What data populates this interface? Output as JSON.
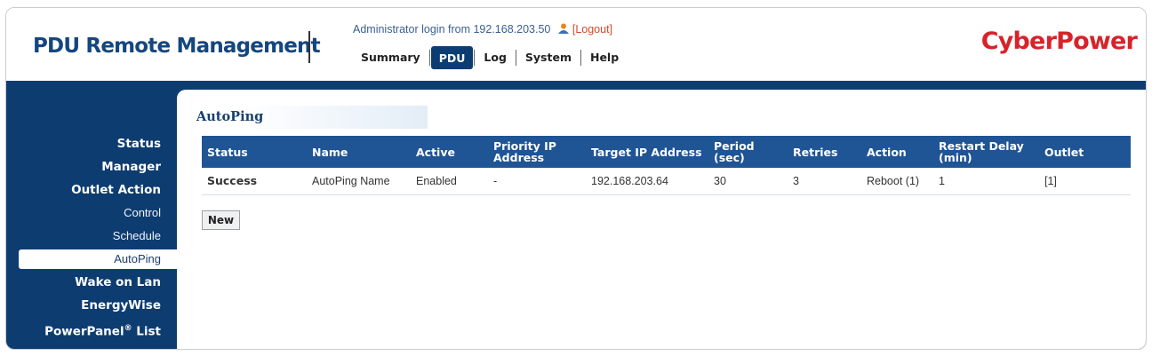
{
  "header": {
    "app_title": "PDU Remote Management",
    "login_prefix": "Administrator login from 192.168.203.50",
    "logout_label": "[Logout]",
    "brand": "CyberPower"
  },
  "nav": {
    "tabs": [
      {
        "label": "Summary"
      },
      {
        "label": "PDU"
      },
      {
        "label": "Log"
      },
      {
        "label": "System"
      },
      {
        "label": "Help"
      }
    ],
    "active": "PDU"
  },
  "sidebar": {
    "items": [
      {
        "label": "Status"
      },
      {
        "label": "Manager"
      },
      {
        "label": "Outlet Action"
      },
      {
        "label": "Control"
      },
      {
        "label": "Schedule"
      },
      {
        "label": "AutoPing"
      },
      {
        "label": "Wake on Lan"
      },
      {
        "label": "EnergyWise"
      },
      {
        "label": "PowerPanel",
        "suffix": "®",
        "rest": " List"
      }
    ],
    "selected": "AutoPing"
  },
  "main": {
    "section_title": "AutoPing",
    "table": {
      "headers": [
        "Status",
        "Name",
        "Active",
        "Priority IP Address",
        "Target IP Address",
        "Period (sec)",
        "Retries",
        "Action",
        "Restart Delay (min)",
        "Outlet"
      ],
      "rows": [
        {
          "status": "Success",
          "name": "AutoPing Name",
          "active": "Enabled",
          "priority_ip": "-",
          "target_ip": "192.168.203.64",
          "period": "30",
          "retries": "3",
          "action": "Reboot (1)",
          "restart_delay": "1",
          "outlet": "[1]"
        }
      ]
    },
    "new_button": "New"
  },
  "colors": {
    "navy": "#0d3c70",
    "header_blue": "#1f5495",
    "brand_red": "#d8232a",
    "success_green": "#3c8a18"
  }
}
